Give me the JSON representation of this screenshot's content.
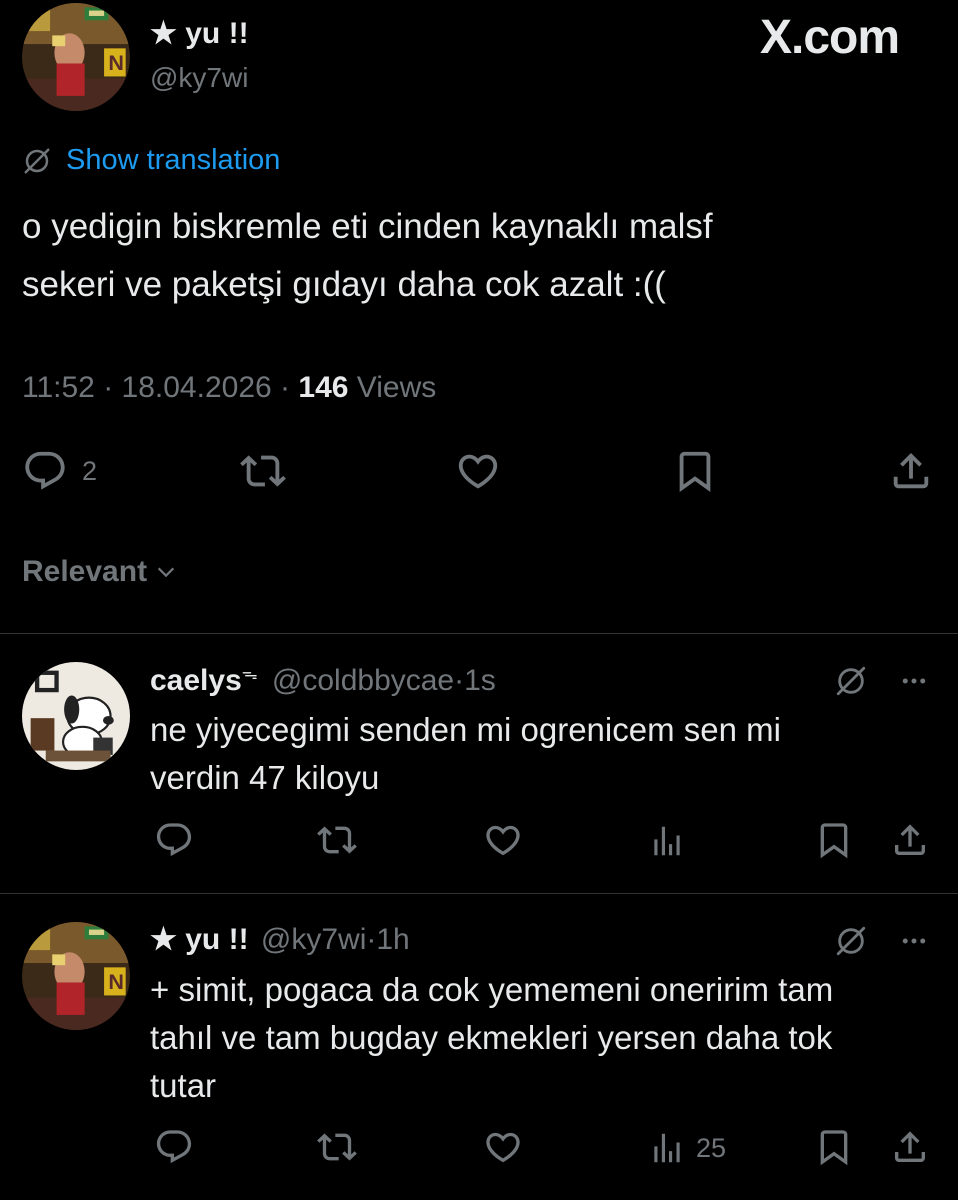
{
  "watermark": "X.com",
  "post": {
    "display_name": "★ yu !!",
    "handle": "@ky7wi",
    "translate_label": "Show translation",
    "text_line1": "o yedigin biskremle eti cinden kaynaklı malsf",
    "text_line2": "sekeri ve paketşi gıdayı daha cok azalt :((",
    "time": "11:52",
    "date": "18.04.2026",
    "views_count": "146",
    "views_label": "Views",
    "reply_count": "2",
    "icons": [
      "translate-icon",
      "reply-icon",
      "repost-icon",
      "like-icon",
      "bookmark-icon",
      "share-icon"
    ]
  },
  "sort": {
    "label": "Relevant",
    "icon": "chevron-down-icon"
  },
  "replies": [
    {
      "display_name": "caelys",
      "badge": "ᯓ",
      "handle": "@coldbbycae",
      "age": "1s",
      "text_line1": "ne yiyecegimi senden mi ogrenicem sen mi",
      "text_line2": "verdin 47 kiloyu",
      "text_line3": "",
      "views_count": ""
    },
    {
      "display_name": "★ yu !!",
      "badge": "",
      "handle": "@ky7wi",
      "age": "1h",
      "text_line1": "+ simit, pogaca da cok yememeni oneririm tam",
      "text_line2": "tahıl ve tam bugday ekmekleri yersen daha tok",
      "text_line3": "tutar",
      "views_count": "25"
    }
  ],
  "separator": "·",
  "colors": {
    "background": "#000000",
    "text": "#e7e9ea",
    "muted": "#71767b",
    "link": "#1d9bf0",
    "divider": "#2f3336"
  }
}
